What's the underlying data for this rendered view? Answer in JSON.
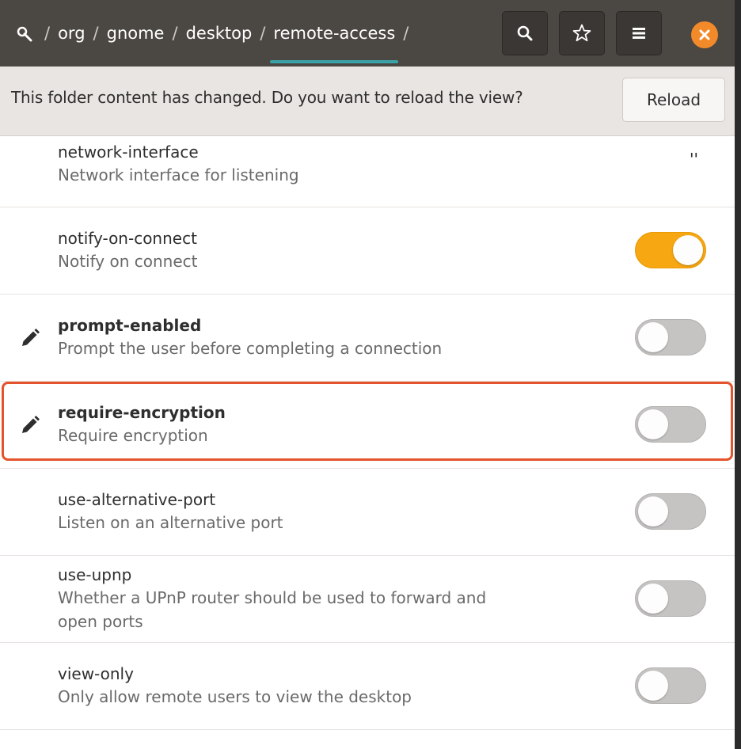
{
  "headerbar": {
    "root_icon": "search-key-icon",
    "path": [
      {
        "label": "org"
      },
      {
        "label": "gnome"
      },
      {
        "label": "desktop"
      },
      {
        "label": "remote-access"
      }
    ],
    "separator": "/",
    "buttons": {
      "search": "search-icon",
      "bookmark": "star-icon",
      "menu": "hamburger-menu-icon",
      "close": "close-icon"
    }
  },
  "infobar": {
    "message": "This folder content has changed. Do you want to reload the view?",
    "reload_label": "Reload"
  },
  "keys": [
    {
      "name": "network-interface",
      "description": "Network interface for listening",
      "value": "''",
      "modified": false
    },
    {
      "name": "notify-on-connect",
      "description": "Notify on connect",
      "value": true,
      "modified": false
    },
    {
      "name": "prompt-enabled",
      "description": "Prompt the user before completing a connection",
      "value": false,
      "modified": true
    },
    {
      "name": "require-encryption",
      "description": "Require encryption",
      "value": false,
      "modified": true,
      "highlighted": true
    },
    {
      "name": "use-alternative-port",
      "description": "Listen on an alternative port",
      "value": false,
      "modified": false
    },
    {
      "name": "use-upnp",
      "description": "Whether a UPnP router should be used to forward and open ports",
      "value": false,
      "modified": false
    },
    {
      "name": "view-only",
      "description": "Only allow remote users to view the desktop",
      "value": false,
      "modified": false
    }
  ],
  "colors": {
    "accent_toggle_on": "#f7a711",
    "close_button": "#f28a2a",
    "highlight_border": "#e4532c",
    "path_underline": "#3aa3a8"
  }
}
